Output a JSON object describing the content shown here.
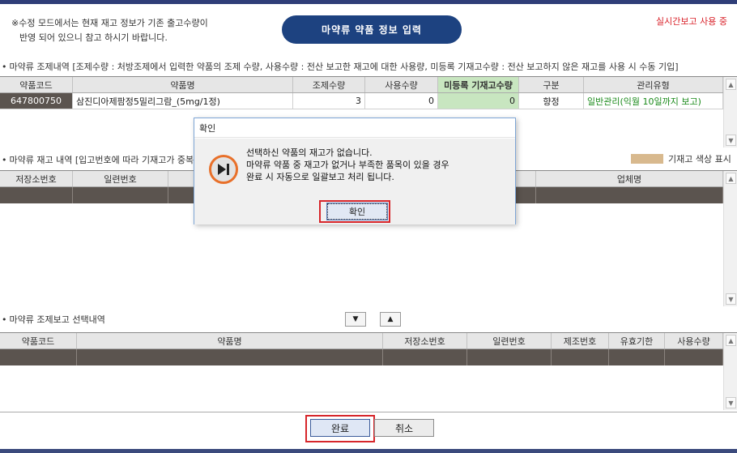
{
  "header": {
    "notice_line1": "※수정 모드에서는 현재 재고 정보가 기존 출고수량이",
    "notice_line2": "반영 되어 있으니 참고 하시기 바랍니다.",
    "title": "마약류 약품 정보 입력",
    "realtime_label": "실시간보고 사용 중"
  },
  "dispense_section": {
    "title": "마약류 조제내역 [조제수량 : 처방조제에서 입력한 약품의 조제 수량, 사용수량 : 전산 보고한 재고에 대한 사용량, 미등록 기재고수량 : 전산 보고하지 않은 재고를 사용 시 수동 기입]",
    "columns": [
      "약품코드",
      "약품명",
      "조제수량",
      "사용수량",
      "미등록 기재고수량",
      "구분",
      "관리유형"
    ],
    "rows": [
      {
        "code": "647800750",
        "name": "삼진디아제팜정5밀리그람_(5mg/1정)",
        "dispense_qty": "3",
        "use_qty": "0",
        "unreg_qty": "0",
        "category": "향정",
        "manage_type": "일반관리(익월 10일까지 보고)"
      }
    ]
  },
  "stock_section": {
    "title": "마약류 재고 내역 [입고번호에 따라 기재고가 중복",
    "legend": "기재고 색상 표시",
    "columns": [
      "저장소번호",
      "일련번호",
      "업체명"
    ]
  },
  "report_section": {
    "title": "마약류 조제보고 선택내역",
    "sort_down": "▼",
    "sort_up": "▲",
    "columns": [
      "약품코드",
      "약품명",
      "저장소번호",
      "일련번호",
      "제조번호",
      "유효기한",
      "사용수량"
    ]
  },
  "dialog": {
    "title": "확인",
    "message_line1": "선택하신 약품의 재고가 없습니다.",
    "message_line2": "마약류 약품 중 재고가 없거나 부족한 품목이 있을 경우",
    "message_line3": "완료 시 자동으로 일괄보고 처리 됩니다.",
    "ok_label": "확인"
  },
  "footer": {
    "complete_label": "완료",
    "cancel_label": "취소"
  },
  "colors": {
    "accent": "#1d4280",
    "highlight_box": "#d7262b",
    "unreg_column": "#c8e6c0",
    "legend_swatch": "#d8b98e",
    "manage_text": "#1a8a1a"
  },
  "icons": {
    "dialog_icon": "play-next-icon",
    "scroll_up": "scroll-up-arrow-icon",
    "scroll_down": "scroll-down-arrow-icon"
  }
}
